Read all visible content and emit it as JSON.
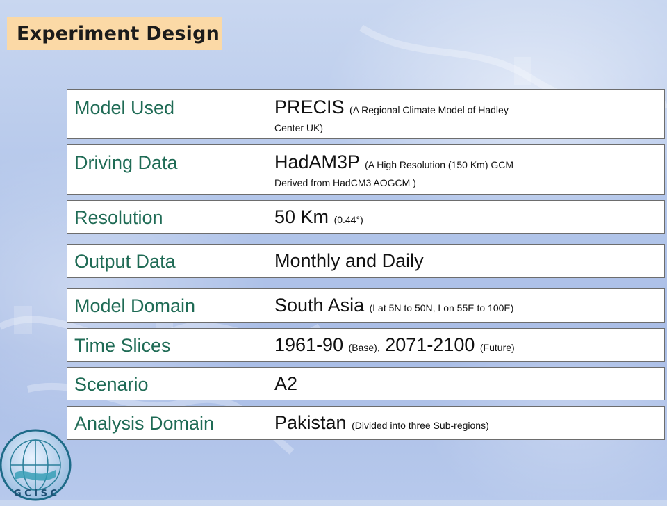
{
  "title": "Experiment Design",
  "rows": [
    {
      "label": "Model Used",
      "value": "PRECIS",
      "note_line1": "(A Regional Climate Model of Hadley",
      "note_line2": "Center UK)"
    },
    {
      "label": "Driving Data",
      "value": "HadAM3P",
      "note_line1": "(A High Resolution (150 Km) GCM",
      "note_line2": "Derived from HadCM3 AOGCM )"
    },
    {
      "label": "Resolution",
      "value": "50 Km",
      "note": "(0.44°)"
    },
    {
      "label": "Output Data",
      "value": "Monthly and Daily"
    },
    {
      "label": "Model Domain",
      "value": "South Asia",
      "note": "(Lat 5N to 50N, Lon 55E to 100E)"
    },
    {
      "label": "Time Slices",
      "value_a": "1961-90",
      "note_a": "(Base),",
      "value_b": "2071-2100",
      "note_b": "(Future)"
    },
    {
      "label": "Scenario",
      "value": "A2"
    },
    {
      "label": "Analysis Domain",
      "value": "Pakistan",
      "note": "(Divided into three Sub-regions)"
    }
  ],
  "logo": {
    "text": "G C I S C",
    "icon": "globe-logo-icon"
  },
  "colors": {
    "label": "#1f6b55",
    "title_bg": "#fbd9a6",
    "background": "#b3c6ea"
  }
}
